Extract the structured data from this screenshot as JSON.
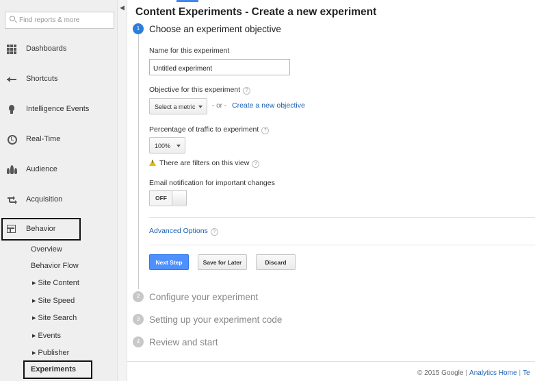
{
  "sidebar": {
    "search_placeholder": "Find reports & more",
    "items": [
      {
        "label": "Dashboards",
        "icon": "grid-icon"
      },
      {
        "label": "Shortcuts",
        "icon": "shortcut-arrow-icon"
      },
      {
        "label": "Intelligence Events",
        "icon": "lightbulb-icon"
      },
      {
        "label": "Real-Time",
        "icon": "clock-icon"
      },
      {
        "label": "Audience",
        "icon": "people-icon"
      },
      {
        "label": "Acquisition",
        "icon": "acquisition-arrows-icon"
      },
      {
        "label": "Behavior",
        "icon": "layout-icon"
      }
    ],
    "behavior_subitems": [
      {
        "label": "Overview",
        "expandable": false
      },
      {
        "label": "Behavior Flow",
        "expandable": false
      },
      {
        "label": "Site Content",
        "expandable": true
      },
      {
        "label": "Site Speed",
        "expandable": true
      },
      {
        "label": "Site Search",
        "expandable": true
      },
      {
        "label": "Events",
        "expandable": true
      },
      {
        "label": "Publisher",
        "expandable": true
      },
      {
        "label": "Experiments",
        "expandable": false
      }
    ]
  },
  "main": {
    "title": "Content Experiments - Create a new experiment",
    "steps": [
      {
        "number": "1",
        "title": "Choose an experiment objective",
        "active": true
      },
      {
        "number": "2",
        "title": "Configure your experiment",
        "active": false
      },
      {
        "number": "3",
        "title": "Setting up your experiment code",
        "active": false
      },
      {
        "number": "4",
        "title": "Review and start",
        "active": false
      }
    ],
    "name_label": "Name for this experiment",
    "name_value": "Untitled experiment",
    "objective_label": "Objective for this experiment",
    "objective_select": "Select a metric",
    "or_text": "- or -",
    "create_objective_link": "Create a new objective",
    "traffic_label": "Percentage of traffic to experiment",
    "traffic_select": "100%",
    "filter_warning": "There are filters on this view",
    "email_label": "Email notification for important changes",
    "toggle_state": "OFF",
    "advanced_options": "Advanced Options",
    "help_glyph": "?",
    "buttons": {
      "next": "Next Step",
      "save": "Save for Later",
      "discard": "Discard"
    }
  },
  "footer": {
    "copyright": "© 2015 Google",
    "analytics_home": "Analytics Home",
    "terms": "Te"
  },
  "colors": {
    "accent_blue": "#4d90fe",
    "link_blue": "#1a5fb4",
    "active_step": "#2d7ed9"
  }
}
